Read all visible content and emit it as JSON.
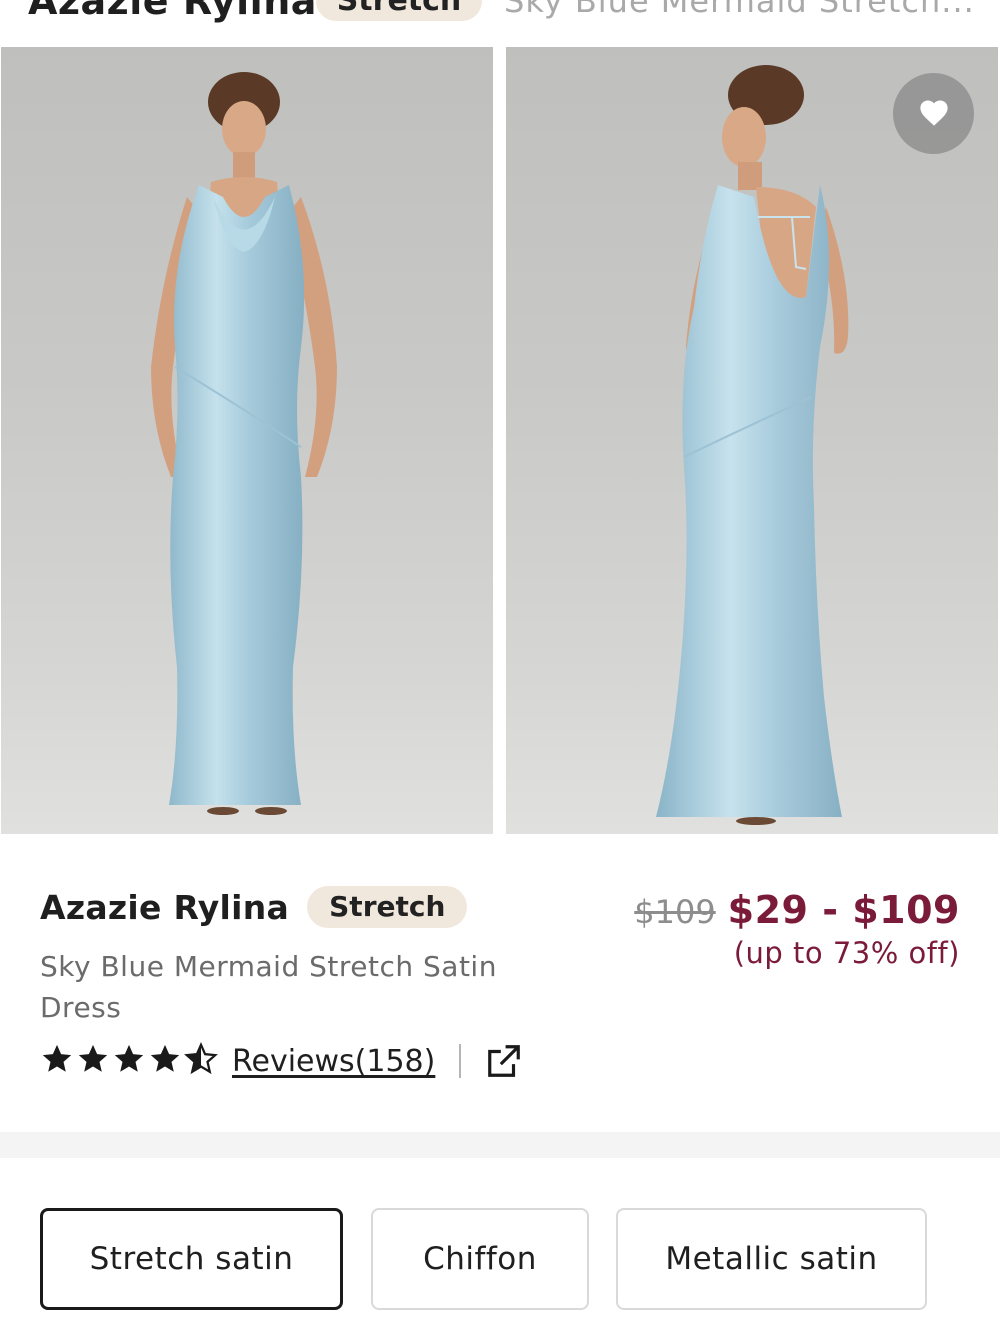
{
  "header": {
    "brand": "Azazie Rylina",
    "badge": "Stretch",
    "subtitle_truncated": "Sky Blue Mermaid Stretch..."
  },
  "gallery": {
    "images": [
      {
        "alt": "front view",
        "icon": "dress-photo-front"
      },
      {
        "alt": "back view",
        "icon": "dress-photo-back"
      }
    ],
    "wishlist_icon": "heart-icon"
  },
  "product": {
    "brand": "Azazie Rylina",
    "badge": "Stretch",
    "subtitle": "Sky Blue Mermaid Stretch Satin Dress",
    "original_price": "$109",
    "price_range": "$29 - $109",
    "discount": "(up to 73% off)",
    "rating": 4.5,
    "rating_max": 5,
    "reviews_label": "Reviews(158)",
    "share_icon": "share-external-icon"
  },
  "fabric": {
    "options": [
      {
        "label": "Stretch satin",
        "selected": true
      },
      {
        "label": "Chiffon",
        "selected": false
      },
      {
        "label": "Metallic satin",
        "selected": false
      }
    ]
  },
  "colors": {
    "price": "#7b1b3a",
    "badge_bg": "#f1e8dd",
    "dress": "#a9cfdf",
    "photo_bg": "#c9c9c7"
  }
}
